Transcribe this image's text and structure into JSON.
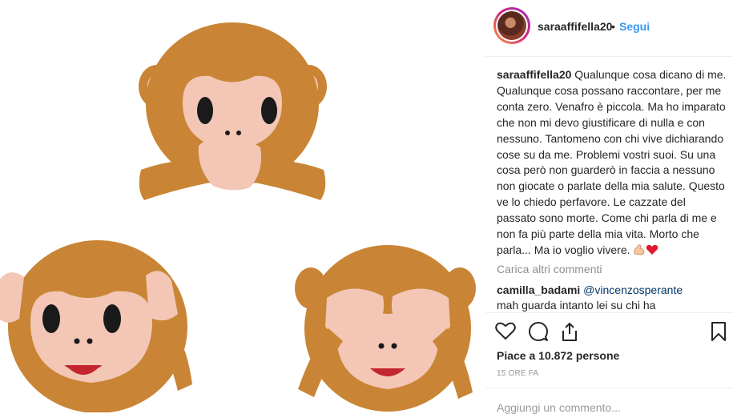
{
  "post": {
    "username": "saraaffifella20",
    "separator": "•",
    "follow_label": "Segui",
    "caption_username": "saraaffifella20",
    "caption_text": " Qualunque cosa dicano di me. Qualunque cosa possano raccontare, per me conta zero. Venafro è piccola. Ma ho imparato che non mi devo giustificare di nulla e con nessuno. Tantomeno con chi vive dichiarando cose su da me. Problemi vostri suoi. Su una cosa però non guarderò in faccia a nessuno non giocate o parlate della mia salute. Questo ve lo chiedo perfavore. Le cazzate del passato sono morte. Come chi parla di me e non fa più parte della mia vita. Morto che parla... Ma io voglio vivere. ",
    "load_more": "Carica altri commenti",
    "comment": {
      "username": "camilla_badami",
      "mention": "@vincenzosperante",
      "text": "mah guarda intanto lei su chi ha"
    },
    "likes": "Piace a 10.872 persone",
    "timestamp": "15 ORE FA",
    "add_comment_placeholder": "Aggiungi un commento..."
  },
  "icons": {
    "like": "heart-outline-icon",
    "comment": "comment-bubble-icon",
    "share": "share-icon",
    "save": "bookmark-icon",
    "flex": "flexed-biceps-emoji",
    "heart": "red-heart-emoji"
  },
  "colors": {
    "link": "#3897f0",
    "text": "#262626",
    "muted": "#8e8e8e",
    "monkey_fur": "#c98535",
    "monkey_face": "#f3c6b5"
  }
}
